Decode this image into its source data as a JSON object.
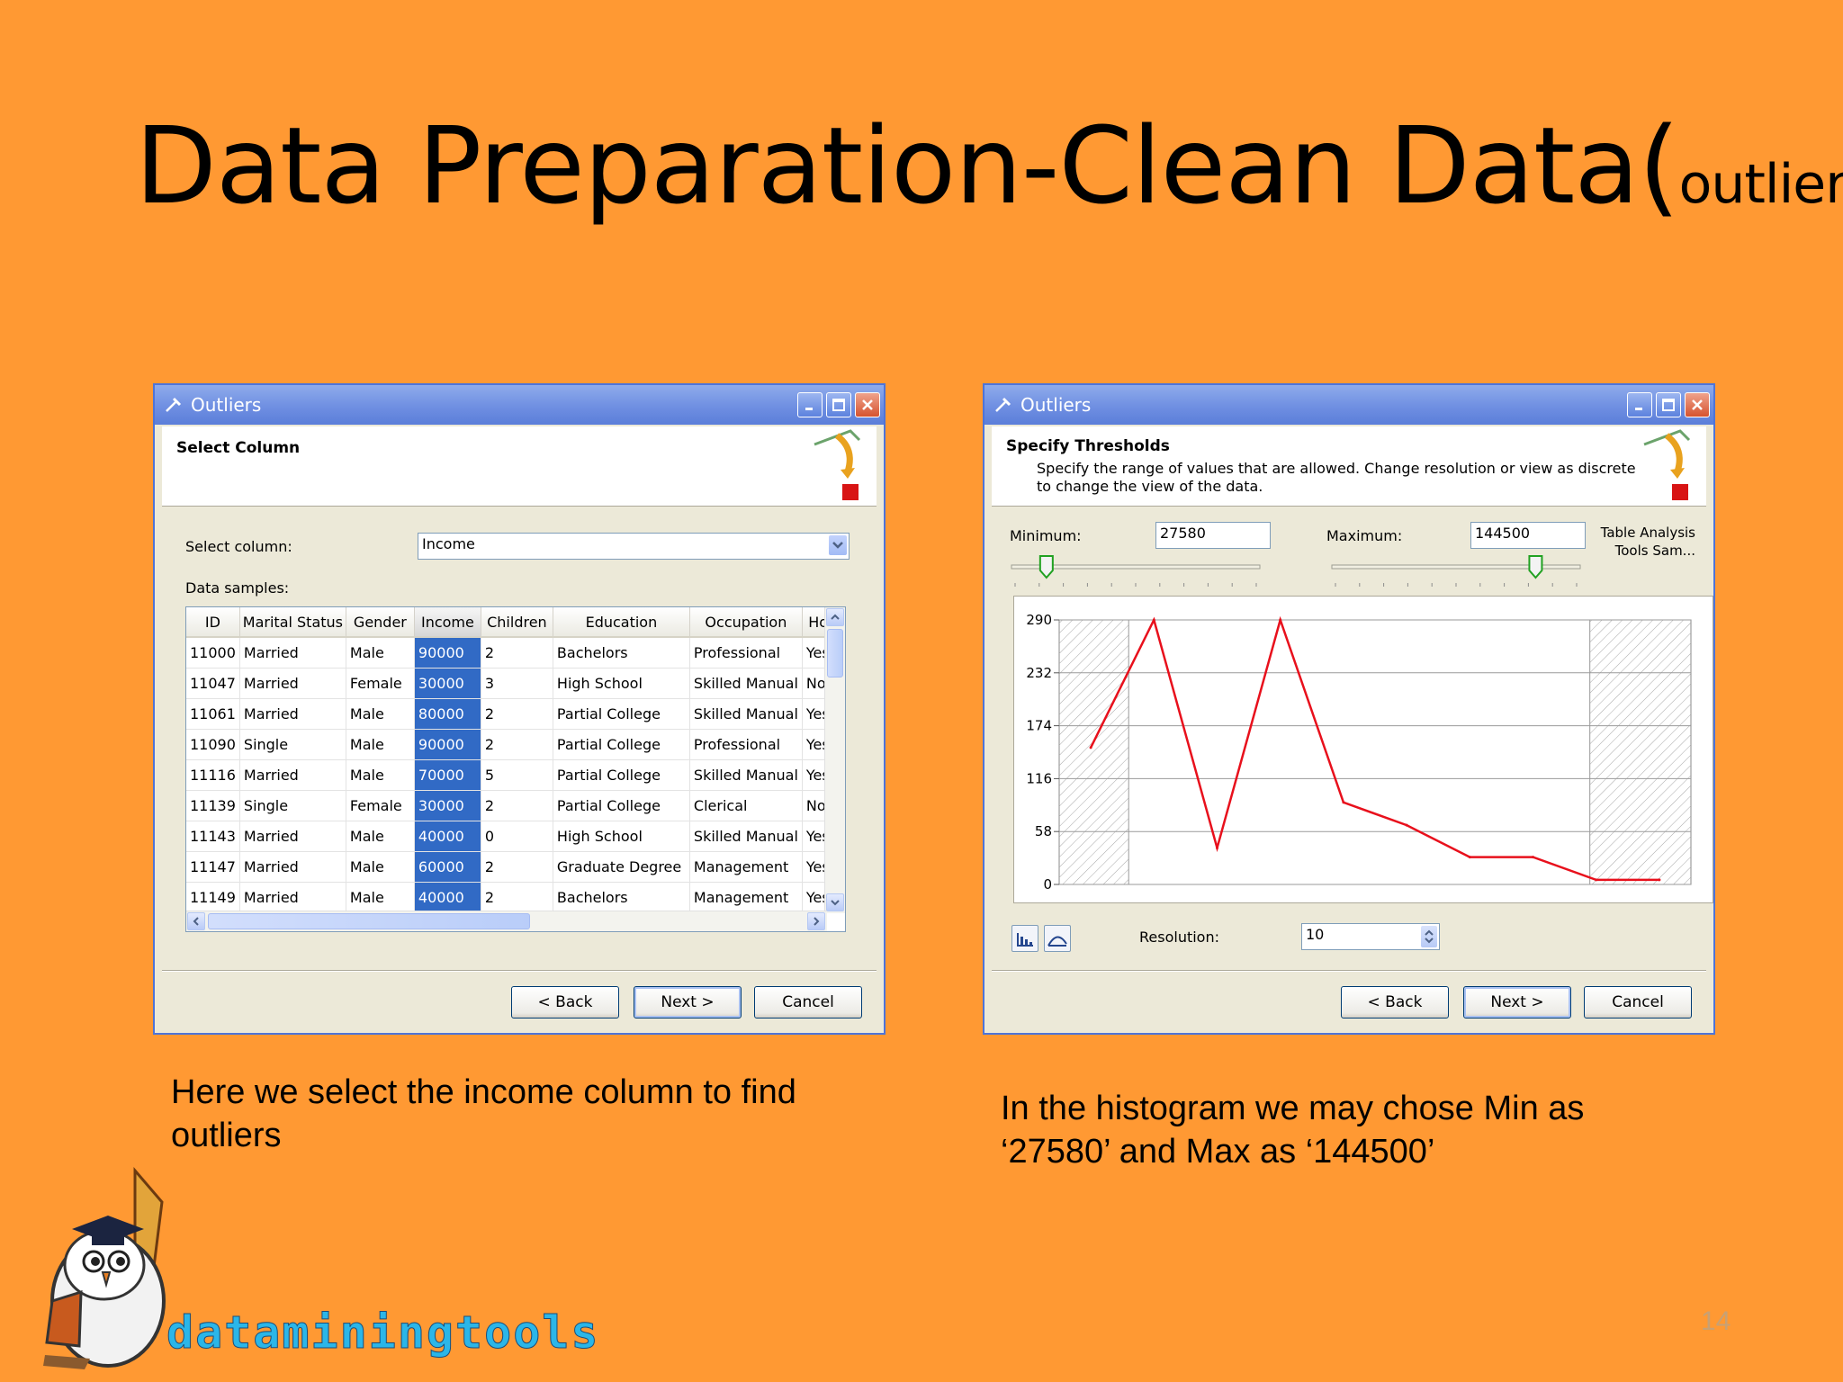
{
  "slide": {
    "title_main": "Data Preparation-Clean Data(",
    "title_small": "outliers",
    "title_close": ")",
    "page_number": "14",
    "logo_text": "dataminingtools"
  },
  "left_window": {
    "title": "Outliers",
    "header_title": "Select Column",
    "select_column_label": "Select column:",
    "select_column_value": "Income",
    "data_samples_label": "Data samples:",
    "columns": [
      "ID",
      "Marital Status",
      "Gender",
      "Income",
      "Children",
      "Education",
      "Occupation",
      "Hor"
    ],
    "rows": [
      [
        "11000",
        "Married",
        "Male",
        "90000",
        "2",
        "Bachelors",
        "Professional",
        "Yes"
      ],
      [
        "11047",
        "Married",
        "Female",
        "30000",
        "3",
        "High School",
        "Skilled Manual",
        "No"
      ],
      [
        "11061",
        "Married",
        "Male",
        "80000",
        "2",
        "Partial College",
        "Skilled Manual",
        "Yes"
      ],
      [
        "11090",
        "Single",
        "Male",
        "90000",
        "2",
        "Partial College",
        "Professional",
        "Yes"
      ],
      [
        "11116",
        "Married",
        "Male",
        "70000",
        "5",
        "Partial College",
        "Skilled Manual",
        "Yes"
      ],
      [
        "11139",
        "Single",
        "Female",
        "30000",
        "2",
        "Partial College",
        "Clerical",
        "No"
      ],
      [
        "11143",
        "Married",
        "Male",
        "40000",
        "0",
        "High School",
        "Skilled Manual",
        "Yes"
      ],
      [
        "11147",
        "Married",
        "Male",
        "60000",
        "2",
        "Graduate Degree",
        "Management",
        "Yes"
      ],
      [
        "11149",
        "Married",
        "Male",
        "40000",
        "2",
        "Bachelors",
        "Management",
        "Yes"
      ]
    ],
    "selected_column_index": 3,
    "buttons": {
      "back": "< Back",
      "next": "Next >",
      "cancel": "Cancel"
    }
  },
  "right_window": {
    "title": "Outliers",
    "header_title": "Specify Thresholds",
    "header_desc": "Specify the range of values that are allowed.  Change resolution or view as discrete to change the view of the data.",
    "minimum_label": "Minimum:",
    "minimum_value": "27580",
    "maximum_label": "Maximum:",
    "maximum_value": "144500",
    "side_note": "Table Analysis Tools Sam...",
    "resolution_label": "Resolution:",
    "resolution_value": "10",
    "min_slider_fraction": 0.13,
    "max_slider_fraction": 0.83,
    "buttons": {
      "back": "< Back",
      "next": "Next >",
      "cancel": "Cancel"
    }
  },
  "chart_data": {
    "type": "line",
    "yticks": [
      0,
      58,
      116,
      174,
      232,
      290
    ],
    "ylim": [
      0,
      290
    ],
    "x": [
      0,
      1,
      2,
      3,
      4,
      5,
      6,
      7,
      8,
      9
    ],
    "values": [
      150,
      290,
      40,
      290,
      90,
      65,
      30,
      30,
      5,
      5
    ],
    "excluded_low_fraction": 0.11,
    "excluded_high_fraction": 0.84,
    "line_color": "#E8101C"
  },
  "captions": {
    "left": "Here we select the income column to find outliers",
    "right": "In the histogram we may chose Min as ‘27580’ and Max as ‘144500’"
  },
  "icons": [
    "wizard-icon",
    "minimize-icon",
    "maximize-icon",
    "close-icon",
    "wizard-decoration-icon",
    "dropdown-arrow-icon",
    "scroll-up-icon",
    "scroll-down-icon",
    "scroll-left-icon",
    "scroll-right-icon",
    "histogram-view-icon",
    "curve-view-icon",
    "spin-icon",
    "owl-mascot-icon"
  ]
}
